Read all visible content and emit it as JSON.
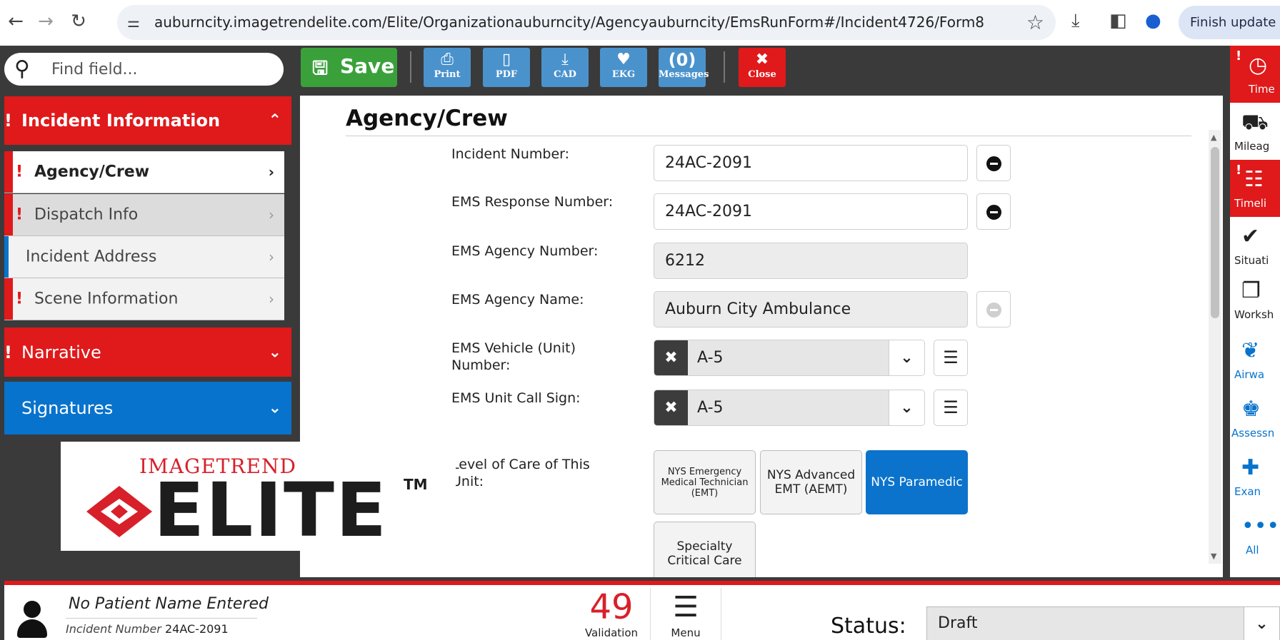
{
  "browser": {
    "url": "auburncity.imagetrendelite.com/Elite/Organizationauburncity/Agencyauburncity/EmsRunForm#/Incident4726/Form8",
    "finish_update": "Finish update"
  },
  "search": {
    "placeholder": "Find field..."
  },
  "sidebar": {
    "incident_information": "Incident Information",
    "items": [
      {
        "label": "Agency/Crew"
      },
      {
        "label": "Dispatch Info"
      },
      {
        "label": "Incident Address"
      },
      {
        "label": "Scene Information"
      }
    ],
    "narrative": "Narrative",
    "signatures": "Signatures"
  },
  "logo": {
    "brand": "IMAGETREND",
    "product": "ELITE",
    "tm": "TM"
  },
  "toolbar": {
    "save": "Save",
    "print": "Print",
    "pdf": "PDF",
    "cad": "CAD",
    "ekg": "EKG",
    "messages_count": "(0)",
    "messages": "Messages",
    "close": "Close"
  },
  "form": {
    "title": "Agency/Crew",
    "incident_number_label": "Incident Number:",
    "incident_number": "24AC-2091",
    "ems_response_label": "EMS Response Number:",
    "ems_response": "24AC-2091",
    "agency_number_label": "EMS Agency Number:",
    "agency_number": "6212",
    "agency_name_label": "EMS Agency Name:",
    "agency_name": "Auburn City Ambulance",
    "vehicle_label": "EMS Vehicle (Unit) Number:",
    "vehicle": "A-5",
    "call_sign_label": "EMS Unit Call Sign:",
    "call_sign": "A-5",
    "level_label": "Level of Care of This Unit:",
    "levels": [
      "NYS Emergency Medical Technician (EMT)",
      "NYS Advanced EMT (AEMT)",
      "NYS Paramedic",
      "Specialty Critical Care"
    ]
  },
  "rail": [
    "Time",
    "Mileag",
    "Timeli",
    "Situati",
    "Worksh",
    "Airwa",
    "Assessn",
    "Exan",
    "All"
  ],
  "bottom": {
    "patient_name": "No Patient Name Entered",
    "incident_key": "Incident Number",
    "incident_value": "24AC-2091",
    "validation_count": "49",
    "validation": "Validation",
    "menu": "Menu",
    "status_label": "Status:",
    "status_value": "Draft"
  }
}
